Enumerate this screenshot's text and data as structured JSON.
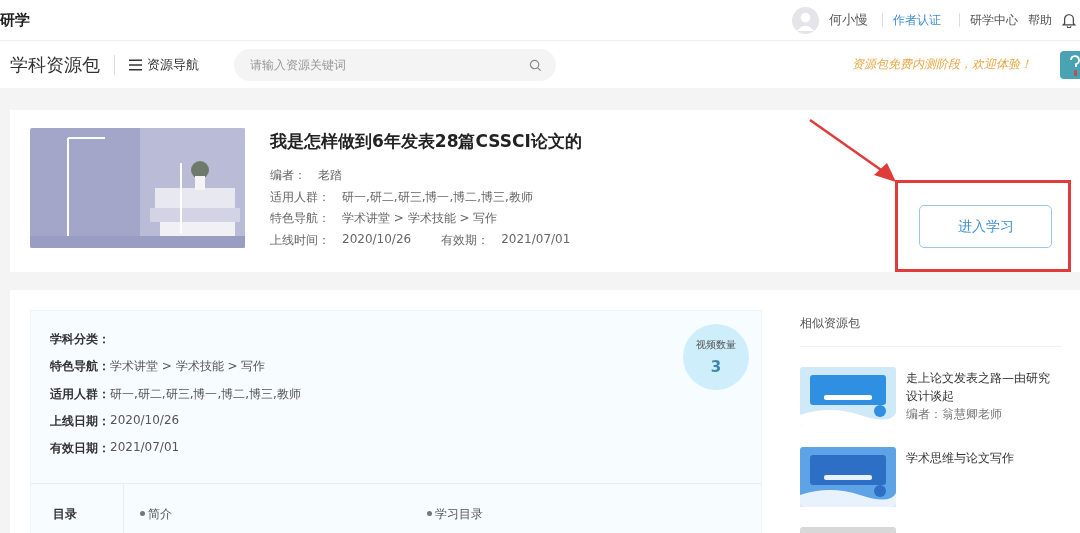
{
  "topbar": {
    "logo": "研学",
    "user": "何小慢",
    "links": [
      {
        "label": "作者认证",
        "selected": true
      },
      {
        "label": "研学中心",
        "selected": false
      },
      {
        "label": "帮助",
        "selected": false
      }
    ]
  },
  "navbar": {
    "title": "学科资源包",
    "menu": "资源导航",
    "search": {
      "placeholder": "请输入资源关键词"
    },
    "notice": "资源包免费内测阶段，欢迎体验！"
  },
  "resource": {
    "title": "我是怎样做到6年发表28篇CSSCI论文的",
    "meta": [
      {
        "label": "编者：",
        "value": "老踏"
      },
      {
        "label": "适用人群：",
        "value": "研一,研二,研三,博一,博二,博三,教师"
      },
      {
        "label": "特色导航：",
        "value": "学术讲堂 > 学术技能 > 写作"
      }
    ],
    "online_label": "上线时间：",
    "online": "2020/10/26",
    "valid_label": "有效期：",
    "valid": "2021/07/01",
    "button": "进入学习"
  },
  "details": {
    "rows": [
      {
        "label": "学科分类："
      },
      {
        "label": "特色导航：",
        "value": "学术讲堂 > 学术技能 > 写作"
      },
      {
        "label": "适用人群：",
        "value": "研一,研二,研三,博一,博二,博三,教师"
      },
      {
        "label": "上线日期：",
        "value": "2020/10/26"
      },
      {
        "label": "有效日期：",
        "value": "2021/07/01"
      }
    ],
    "badge_label": "视频数量",
    "badge_value": "3",
    "toc_label": "目录",
    "toc": [
      "简介",
      "学习目录"
    ]
  },
  "similar": {
    "title": "相似资源包",
    "items": [
      {
        "title": "走上论文发表之路—由研究设计谈起",
        "author": "编者：翁慧卿老师",
        "kind": "picture"
      },
      {
        "title": "学术思维与论文写作",
        "kind": "picture"
      },
      {
        "kind": "picture"
      }
    ]
  }
}
